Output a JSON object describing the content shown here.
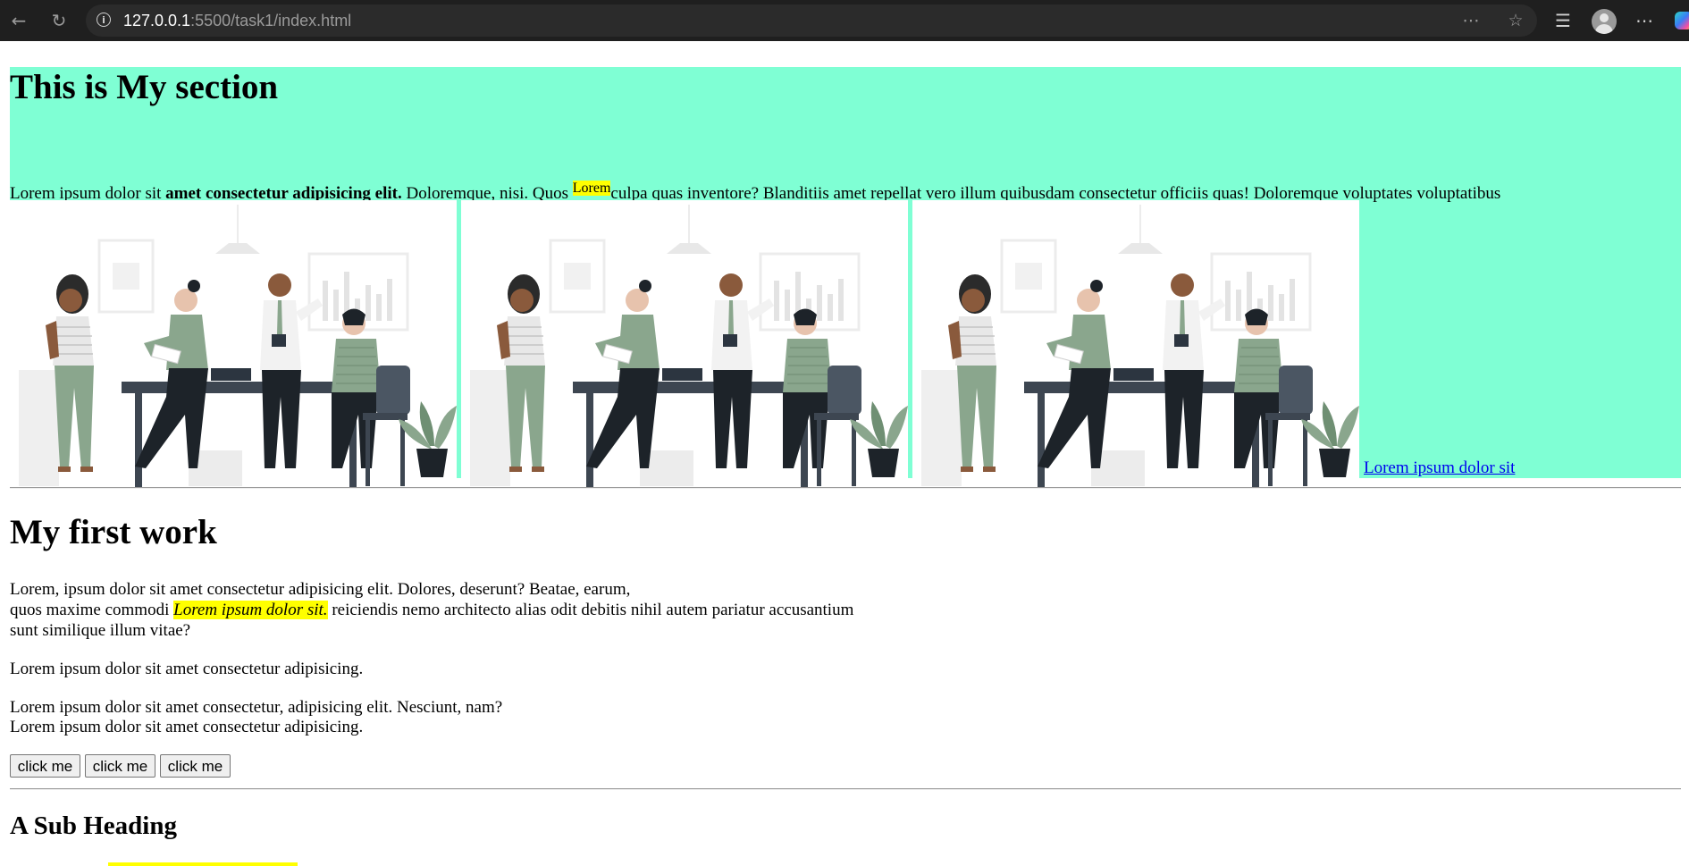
{
  "browser": {
    "url_host": "127.0.0.1",
    "url_rest": ":5500/task1/index.html"
  },
  "section": {
    "heading": "This is My section",
    "para_start": "Lorem ipsum dolor sit ",
    "para_bold": "amet consectetur adipisicing elit.",
    "para_mid": " Doloremque, nisi. Quos ",
    "para_sup": "Lorem",
    "para_end": "culpa quas inventore? Blanditiis amet repellat vero illum quibusdam consectetur officiis quas! Doloremque voluptates voluptatibus",
    "link_text": "Lorem ipsum dolor sit",
    "bg_color": "#7fffd4"
  },
  "work": {
    "heading": "My first work",
    "p1_line1": "Lorem, ipsum dolor sit amet consectetur adipisicing elit. Dolores, deserunt? Beatae, earum,",
    "p1_line2_start": "quos maxime commodi ",
    "p1_line2_em": "Lorem ipsum dolor sit.",
    "p1_line2_end": " reiciendis nemo architecto alias odit debitis nihil autem pariatur accusantium",
    "p1_line3": "sunt similique illum vitae?",
    "p2": "Lorem ipsum dolor sit amet consectetur adipisicing.",
    "p3_line1": "Lorem ipsum dolor sit amet consectetur, adipisicing elit. Nesciunt, nam?",
    "p3_line2": "Lorem ipsum dolor sit amet consectetur adipisicing.",
    "buttons": [
      "click me",
      "click me",
      "click me"
    ]
  },
  "sub": {
    "heading": "A Sub Heading"
  }
}
